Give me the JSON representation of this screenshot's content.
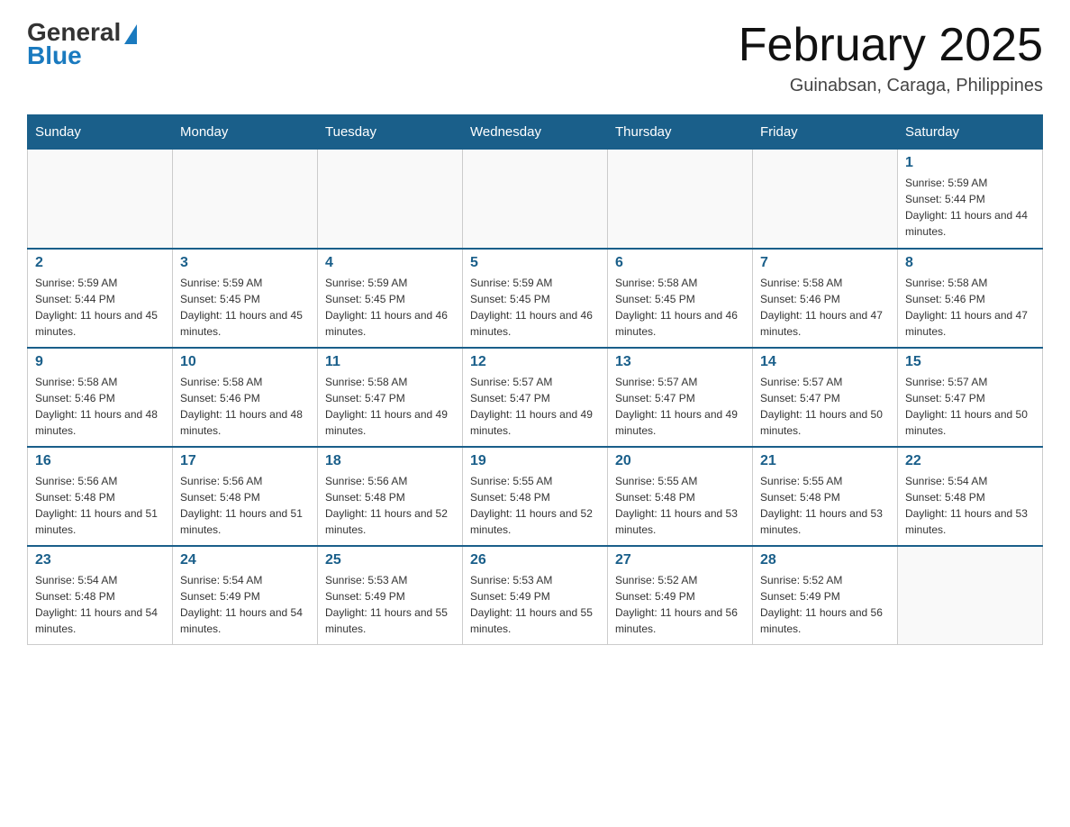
{
  "header": {
    "logo_general": "General",
    "logo_blue": "Blue",
    "title": "February 2025",
    "subtitle": "Guinabsan, Caraga, Philippines"
  },
  "days_of_week": [
    "Sunday",
    "Monday",
    "Tuesday",
    "Wednesday",
    "Thursday",
    "Friday",
    "Saturday"
  ],
  "weeks": [
    [
      {
        "day": "",
        "info": ""
      },
      {
        "day": "",
        "info": ""
      },
      {
        "day": "",
        "info": ""
      },
      {
        "day": "",
        "info": ""
      },
      {
        "day": "",
        "info": ""
      },
      {
        "day": "",
        "info": ""
      },
      {
        "day": "1",
        "info": "Sunrise: 5:59 AM\nSunset: 5:44 PM\nDaylight: 11 hours and 44 minutes."
      }
    ],
    [
      {
        "day": "2",
        "info": "Sunrise: 5:59 AM\nSunset: 5:44 PM\nDaylight: 11 hours and 45 minutes."
      },
      {
        "day": "3",
        "info": "Sunrise: 5:59 AM\nSunset: 5:45 PM\nDaylight: 11 hours and 45 minutes."
      },
      {
        "day": "4",
        "info": "Sunrise: 5:59 AM\nSunset: 5:45 PM\nDaylight: 11 hours and 46 minutes."
      },
      {
        "day": "5",
        "info": "Sunrise: 5:59 AM\nSunset: 5:45 PM\nDaylight: 11 hours and 46 minutes."
      },
      {
        "day": "6",
        "info": "Sunrise: 5:58 AM\nSunset: 5:45 PM\nDaylight: 11 hours and 46 minutes."
      },
      {
        "day": "7",
        "info": "Sunrise: 5:58 AM\nSunset: 5:46 PM\nDaylight: 11 hours and 47 minutes."
      },
      {
        "day": "8",
        "info": "Sunrise: 5:58 AM\nSunset: 5:46 PM\nDaylight: 11 hours and 47 minutes."
      }
    ],
    [
      {
        "day": "9",
        "info": "Sunrise: 5:58 AM\nSunset: 5:46 PM\nDaylight: 11 hours and 48 minutes."
      },
      {
        "day": "10",
        "info": "Sunrise: 5:58 AM\nSunset: 5:46 PM\nDaylight: 11 hours and 48 minutes."
      },
      {
        "day": "11",
        "info": "Sunrise: 5:58 AM\nSunset: 5:47 PM\nDaylight: 11 hours and 49 minutes."
      },
      {
        "day": "12",
        "info": "Sunrise: 5:57 AM\nSunset: 5:47 PM\nDaylight: 11 hours and 49 minutes."
      },
      {
        "day": "13",
        "info": "Sunrise: 5:57 AM\nSunset: 5:47 PM\nDaylight: 11 hours and 49 minutes."
      },
      {
        "day": "14",
        "info": "Sunrise: 5:57 AM\nSunset: 5:47 PM\nDaylight: 11 hours and 50 minutes."
      },
      {
        "day": "15",
        "info": "Sunrise: 5:57 AM\nSunset: 5:47 PM\nDaylight: 11 hours and 50 minutes."
      }
    ],
    [
      {
        "day": "16",
        "info": "Sunrise: 5:56 AM\nSunset: 5:48 PM\nDaylight: 11 hours and 51 minutes."
      },
      {
        "day": "17",
        "info": "Sunrise: 5:56 AM\nSunset: 5:48 PM\nDaylight: 11 hours and 51 minutes."
      },
      {
        "day": "18",
        "info": "Sunrise: 5:56 AM\nSunset: 5:48 PM\nDaylight: 11 hours and 52 minutes."
      },
      {
        "day": "19",
        "info": "Sunrise: 5:55 AM\nSunset: 5:48 PM\nDaylight: 11 hours and 52 minutes."
      },
      {
        "day": "20",
        "info": "Sunrise: 5:55 AM\nSunset: 5:48 PM\nDaylight: 11 hours and 53 minutes."
      },
      {
        "day": "21",
        "info": "Sunrise: 5:55 AM\nSunset: 5:48 PM\nDaylight: 11 hours and 53 minutes."
      },
      {
        "day": "22",
        "info": "Sunrise: 5:54 AM\nSunset: 5:48 PM\nDaylight: 11 hours and 53 minutes."
      }
    ],
    [
      {
        "day": "23",
        "info": "Sunrise: 5:54 AM\nSunset: 5:48 PM\nDaylight: 11 hours and 54 minutes."
      },
      {
        "day": "24",
        "info": "Sunrise: 5:54 AM\nSunset: 5:49 PM\nDaylight: 11 hours and 54 minutes."
      },
      {
        "day": "25",
        "info": "Sunrise: 5:53 AM\nSunset: 5:49 PM\nDaylight: 11 hours and 55 minutes."
      },
      {
        "day": "26",
        "info": "Sunrise: 5:53 AM\nSunset: 5:49 PM\nDaylight: 11 hours and 55 minutes."
      },
      {
        "day": "27",
        "info": "Sunrise: 5:52 AM\nSunset: 5:49 PM\nDaylight: 11 hours and 56 minutes."
      },
      {
        "day": "28",
        "info": "Sunrise: 5:52 AM\nSunset: 5:49 PM\nDaylight: 11 hours and 56 minutes."
      },
      {
        "day": "",
        "info": ""
      }
    ]
  ]
}
